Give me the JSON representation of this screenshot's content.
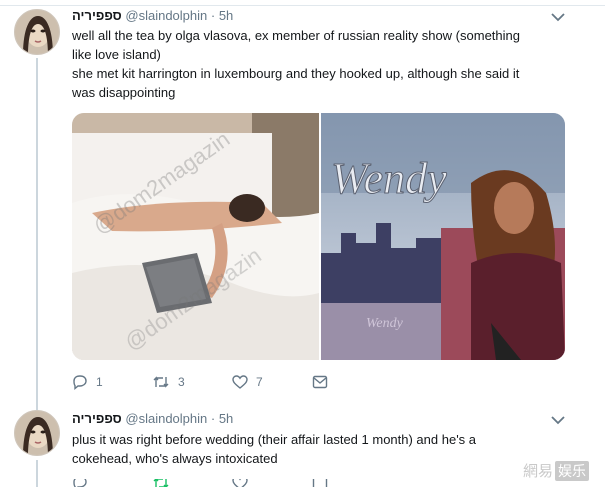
{
  "tweets": [
    {
      "display_name": "ספפיריה",
      "handle": "@slaindolphin",
      "time": "· 5h",
      "lines": [
        "well all the tea by olga vlasova, ex member of russian reality show (something",
        "like love island)",
        "she met kit harrington in luxembourg and they hooked up, although she said it",
        "was disappointing"
      ],
      "media": {
        "left_watermark": "@dom2magazin",
        "right_title": "Wendy",
        "right_floor_logo": "Wendy"
      },
      "actions": {
        "replies": "1",
        "retweets": "3",
        "likes": "7"
      }
    },
    {
      "display_name": "ספפיריה",
      "handle": "@slaindolphin",
      "time": "· 5h",
      "lines": [
        "plus it was right before wedding (their affair lasted 1 month) and he's a",
        "cokehead, who's always intoxicated"
      ]
    }
  ],
  "watermark": {
    "text": "網易",
    "boxed": "娱乐"
  },
  "icons": [
    "chevron-down-icon",
    "reply-icon",
    "retweet-icon",
    "like-icon",
    "dm-icon"
  ],
  "colors": {
    "text": "#14171a",
    "muted": "#657786",
    "retweet_green": "#17bf63"
  }
}
